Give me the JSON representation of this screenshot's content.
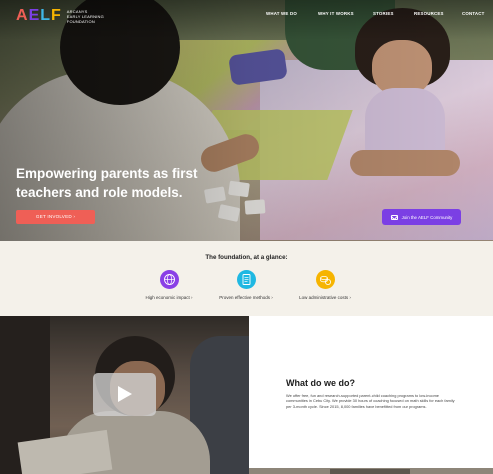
{
  "header": {
    "logo_letters": [
      "A",
      "E",
      "L",
      "F"
    ],
    "logo_colors": [
      "#ef5f56",
      "#7b3fe4",
      "#3fb7e6",
      "#f7b500"
    ],
    "org_name_lines": [
      "ARCANYS",
      "EARLY LEARNING",
      "FOUNDATION"
    ],
    "nav": [
      "WHAT WE DO",
      "WHY IT WORKS",
      "STORIES",
      "RESOURCES",
      "CONTACT"
    ]
  },
  "hero": {
    "title": "Empowering parents as first teachers and role models.",
    "cta_label": "GET INVOLVED  ›",
    "community_label": "Join the AELF Community",
    "community_icon": "mail-icon"
  },
  "glance": {
    "title": "The foundation, at a glance:",
    "features": [
      {
        "label": "High economic impact  ›",
        "icon": "globe-icon",
        "color": "#8a3fe6"
      },
      {
        "label": "Proven effective methods  ›",
        "icon": "document-icon",
        "color": "#1fb8e2"
      },
      {
        "label": "Low administrative costs  ›",
        "icon": "coins-icon",
        "color": "#f6b400"
      }
    ]
  },
  "about": {
    "title": "What do we do?",
    "body": "We offer free, fun and research-supported parent-child coaching programs to low-income communities in Cebu City. We provide 30 hours of coaching focused on math skills for each family per 3-month cycle. Since 2015, 8,000 families have benefitted from our programs."
  },
  "video": {
    "play_icon": "play-icon"
  }
}
